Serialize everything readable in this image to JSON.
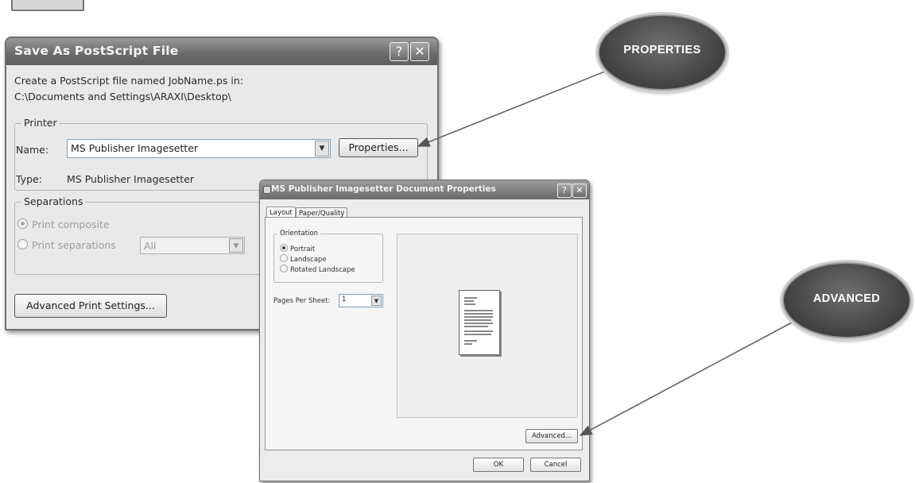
{
  "save_dialog": {
    "title": "Save As PostScript File",
    "description_line1": "Create a PostScript file named JobName.ps in:",
    "description_line2": "C:\\Documents and Settings\\ARAXI\\Desktop\\",
    "printer_group_label": "Printer",
    "name_label": "Name:",
    "name_value": "MS Publisher Imagesetter",
    "properties_button": "Properties...",
    "type_label": "Type:",
    "type_value": "MS Publisher Imagesetter",
    "separations_group_label": "Separations",
    "print_composite": "Print composite",
    "print_separations": "Print separations",
    "separations_value": "All",
    "advanced_print_settings_button": "Advanced Print Settings...",
    "help_glyph": "?",
    "close_glyph": "✕"
  },
  "doc_props_dialog": {
    "title": "MS Publisher Imagesetter Document Properties",
    "tabs": [
      "Layout",
      "Paper/Quality"
    ],
    "orientation_label": "Orientation",
    "orientation_options": [
      "Portrait",
      "Landscape",
      "Rotated Landscape"
    ],
    "orientation_selected": "Portrait",
    "pages_per_sheet_label": "Pages Per Sheet:",
    "pages_per_sheet_value": "1",
    "advanced_button": "Advanced...",
    "ok_button": "OK",
    "cancel_button": "Cancel",
    "help_glyph": "?",
    "close_glyph": "✕",
    "dropdown_glyph": "▼"
  },
  "callouts": {
    "properties": "PROPERTIES",
    "advanced": "ADVANCED"
  },
  "icons": {
    "dropdown": "chevron-down-icon",
    "help": "help-icon",
    "close": "close-icon"
  },
  "colors": {
    "callout_fill": "#4a4a4a",
    "titlebar": "#6c6c6c"
  }
}
